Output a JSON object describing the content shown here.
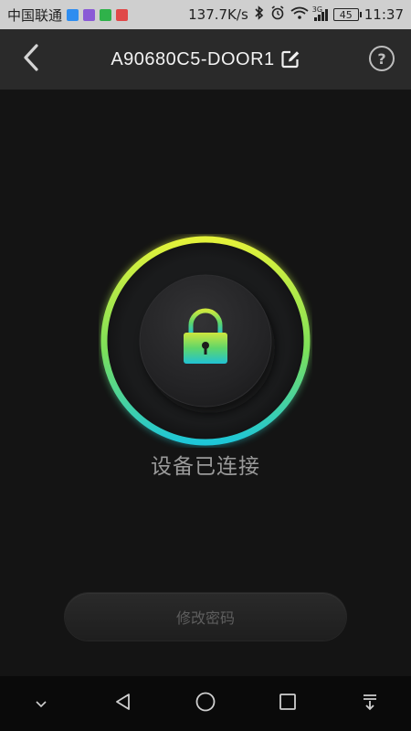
{
  "status_bar": {
    "carrier": "中国联通",
    "net_speed": "137.7K/s",
    "signal_type": "3G",
    "battery": "45",
    "time": "11:37",
    "app_icons": [
      {
        "name": "message-app-icon",
        "color": "#2f8df0"
      },
      {
        "name": "purple-app-icon",
        "color": "#8a5ad6"
      },
      {
        "name": "wechat-icon",
        "color": "#2fb24a"
      },
      {
        "name": "home-app-icon",
        "color": "#e04848"
      }
    ]
  },
  "header": {
    "title": "A90680C5-DOOR1",
    "back_icon": "chevron-left-icon",
    "edit_icon": "edit-icon",
    "help_label": "?"
  },
  "lock": {
    "icon": "lock-icon",
    "ring_colors": [
      "#e4f23a",
      "#7be05a",
      "#1ec6d8"
    ],
    "status_text": "设备已连接"
  },
  "actions": {
    "change_password_label": "修改密码"
  },
  "nav": {
    "icons": [
      "chevron-down-icon",
      "back-triangle-icon",
      "home-circle-icon",
      "recents-square-icon",
      "notification-pull-icon"
    ]
  }
}
